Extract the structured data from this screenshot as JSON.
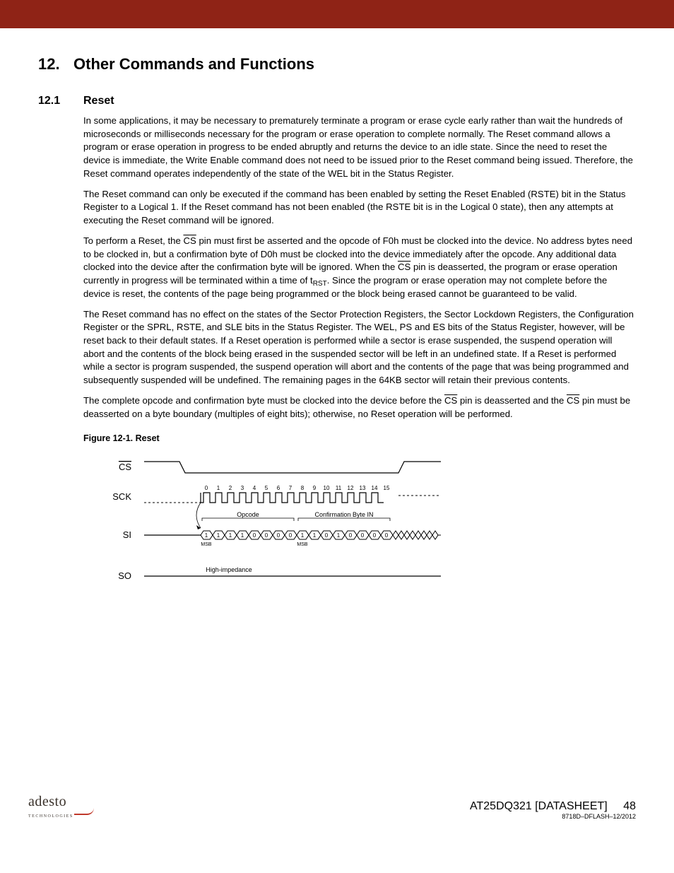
{
  "section": {
    "number": "12.",
    "title": "Other Commands and Functions"
  },
  "subsection": {
    "number": "12.1",
    "title": "Reset"
  },
  "paragraphs": {
    "p1": "In some applications, it may be necessary to prematurely terminate a program or erase cycle early rather than wait the hundreds of microseconds or milliseconds necessary for the program or erase operation to complete normally. The Reset command allows a program or erase operation in progress to be ended abruptly and returns the device to an idle state. Since the need to reset the device is immediate, the Write Enable command does not need to be issued prior to the Reset command being issued. Therefore, the Reset command operates independently of the state of the WEL bit in the Status Register.",
    "p2": "The Reset command can only be executed if the command has been enabled by setting the Reset Enabled (RSTE) bit in the Status Register to a Logical 1. If the Reset command has not been enabled (the RSTE bit is in the Logical 0 state), then any attempts at executing the Reset command will be ignored.",
    "p3a": "To perform a Reset, the ",
    "p3b": " pin must first be asserted and the opcode of F0h must be clocked into the device. No address bytes need to be clocked in, but a confirmation byte of D0h must be clocked into the device immediately after the opcode. Any additional data clocked into the device after the confirmation byte will be ignored. When the ",
    "p3c": " pin is deasserted, the program or erase operation currently in progress will be terminated within a time of t",
    "p3d": ". Since the program or erase operation may not complete before the device is reset, the contents of the page being programmed or the block being erased cannot be guaranteed to be valid.",
    "p4": "The Reset command has no effect on the states of the Sector Protection Registers, the Sector Lockdown Registers, the Configuration Register or the SPRL, RSTE, and SLE bits in the Status Register. The WEL, PS and ES bits of the Status Register, however, will be reset back to their default states. If a Reset operation is performed while a sector is erase suspended, the suspend operation will abort and the contents of the block being erased in the suspended sector will be left in an undefined state. If a Reset is performed while a sector is program suspended, the suspend operation will abort and the contents of the page that was being programmed and subsequently suspended will be undefined. The remaining pages in the 64KB sector will retain their previous contents.",
    "p5a": "The complete opcode and confirmation byte must be clocked into the device before the ",
    "p5b": " pin is deasserted and the ",
    "p5c": " pin must be deasserted on a byte boundary (multiples of eight bits); otherwise, no Reset operation will be performed."
  },
  "cs_label": "CS",
  "rst_sub": "RST",
  "figure": {
    "caption": "Figure 12-1.  Reset"
  },
  "timing": {
    "labels": {
      "cs": "CS",
      "sck": "SCK",
      "si": "SI",
      "so": "SO"
    },
    "clock_numbers": [
      "0",
      "1",
      "2",
      "3",
      "4",
      "5",
      "6",
      "7",
      "8",
      "9",
      "10",
      "11",
      "12",
      "13",
      "14",
      "15"
    ],
    "opcode_label": "Opcode",
    "conf_label": "Confirmation Byte IN",
    "si_bits": [
      "1",
      "1",
      "1",
      "1",
      "0",
      "0",
      "0",
      "0",
      "1",
      "1",
      "0",
      "1",
      "0",
      "0",
      "0",
      "0"
    ],
    "msb": "MSB",
    "so_label": "High-impedance"
  },
  "footer": {
    "brand": "adesto",
    "brand_sub": "TECHNOLOGIES",
    "doc_title": "AT25DQ321 [DATASHEET]",
    "page": "48",
    "docid": "8718D–DFLASH–12/2012"
  }
}
